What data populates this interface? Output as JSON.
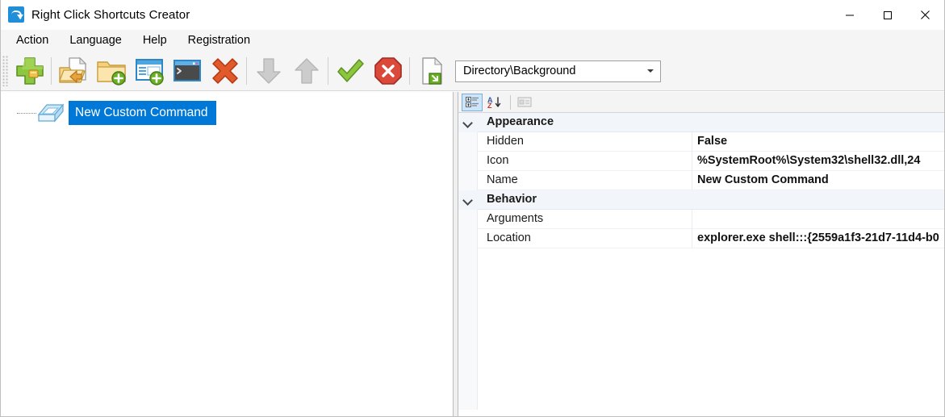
{
  "window": {
    "title": "Right Click Shortcuts Creator",
    "app_icon": "share-arrow-icon",
    "controls": {
      "minimize": "minimize-icon",
      "maximize": "maximize-icon",
      "close": "close-icon"
    }
  },
  "menubar": {
    "items": [
      {
        "label": "Action"
      },
      {
        "label": "Language"
      },
      {
        "label": "Help"
      },
      {
        "label": "Registration"
      }
    ]
  },
  "toolbar": {
    "buttons": [
      {
        "name": "add-command-button",
        "icon": "green-plus-icon",
        "tooltip": "Add"
      },
      {
        "name": "open-file-button",
        "icon": "open-document-icon",
        "tooltip": "Open"
      },
      {
        "name": "new-folder-button",
        "icon": "folder-add-icon",
        "tooltip": "New Folder"
      },
      {
        "name": "new-dialog-button",
        "icon": "window-add-icon",
        "tooltip": "New Window"
      },
      {
        "name": "new-console-button",
        "icon": "console-icon",
        "tooltip": "New Console Command"
      },
      {
        "name": "delete-button",
        "icon": "red-x-icon",
        "tooltip": "Delete"
      },
      {
        "name": "move-down-button",
        "icon": "arrow-down-icon",
        "tooltip": "Move Down"
      },
      {
        "name": "move-up-button",
        "icon": "arrow-up-icon",
        "tooltip": "Move Up"
      },
      {
        "name": "apply-button",
        "icon": "green-check-icon",
        "tooltip": "Apply"
      },
      {
        "name": "cancel-button",
        "icon": "red-stop-icon",
        "tooltip": "Cancel"
      },
      {
        "name": "export-button",
        "icon": "page-export-icon",
        "tooltip": "Export"
      }
    ],
    "context_combo": {
      "value": "Directory\\Background",
      "arrow_icon": "chevron-down-icon"
    }
  },
  "tree": {
    "nodes": [
      {
        "label": "New Custom Command",
        "icon": "window-3d-icon",
        "selected": true
      }
    ]
  },
  "property_grid": {
    "toolbar": {
      "categorized": {
        "label": "Categorized",
        "icon": "categorized-icon",
        "active": true
      },
      "alphabetical": {
        "label": "Alphabetical",
        "icon": "sort-az-icon",
        "active": false
      },
      "property_pages": {
        "label": "Property Pages",
        "icon": "property-pages-icon",
        "disabled": true
      }
    },
    "categories": [
      {
        "name": "Appearance",
        "expanded": true,
        "expander_icon": "chevron-down-icon",
        "properties": [
          {
            "name": "Hidden",
            "value": "False"
          },
          {
            "name": "Icon",
            "value": "%SystemRoot%\\System32\\shell32.dll,24"
          },
          {
            "name": "Name",
            "value": "New Custom Command"
          }
        ]
      },
      {
        "name": "Behavior",
        "expanded": true,
        "expander_icon": "chevron-down-icon",
        "properties": [
          {
            "name": "Arguments",
            "value": ""
          },
          {
            "name": "Location",
            "value": "explorer.exe shell:::{2559a1f3-21d7-11d4-b0"
          }
        ]
      }
    ]
  },
  "colors": {
    "selection_blue": "#0078d7",
    "toolbar_bg": "#f5f5f5",
    "category_row_bg": "#f2f5f9",
    "accent_green": "#76b82a",
    "accent_red": "#d9452c"
  }
}
